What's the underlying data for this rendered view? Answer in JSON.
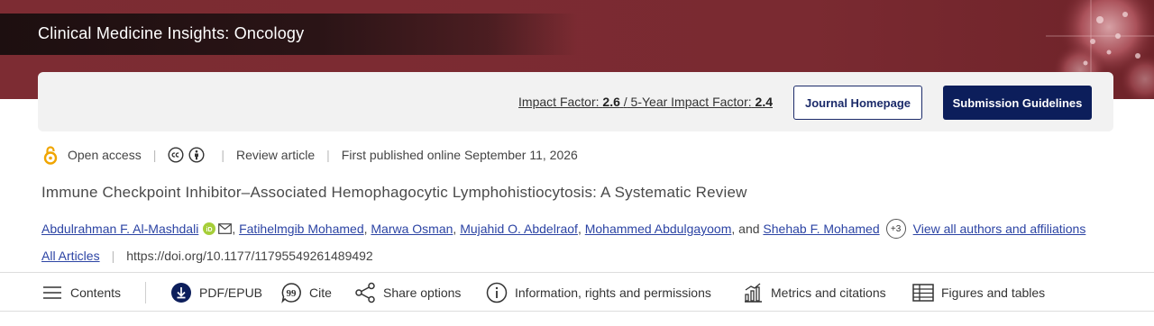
{
  "journal": {
    "title": "Clinical Medicine Insights: Oncology"
  },
  "info_bar": {
    "impact_label": "Impact Factor:",
    "impact_value": "2.6",
    "slash": "/",
    "five_year_label": "5-Year Impact Factor:",
    "five_year_value": "2.4",
    "homepage_button": "Journal Homepage",
    "guidelines_button": "Submission Guidelines"
  },
  "meta": {
    "access": "Open access",
    "article_type": "Review article",
    "published": "First published online September 11, 2026",
    "separator": "|"
  },
  "article": {
    "title": "Immune Checkpoint Inhibitor–Associated Hemophagocytic Lymphohistiocytosis: A Systematic Review",
    "authors": [
      "Abdulrahman F. Al-Mashdali",
      "Fatihelmgib Mohamed",
      "Marwa Osman",
      "Mujahid O. Abdelraof",
      "Mohammed Abdulgayoom",
      "Shehab F. Mohamed"
    ],
    "comma": ",",
    "and_text": ", and",
    "more_authors": "+3",
    "view_all": "View all authors and affiliations",
    "all_articles": "All Articles",
    "doi": "https://doi.org/10.1177/11795549261489492"
  },
  "toolbar": {
    "contents": "Contents",
    "pdf": "PDF/EPUB",
    "cite": "Cite",
    "share": "Share options",
    "info": "Information, rights and permissions",
    "metrics": "Metrics and citations",
    "figures": "Figures and tables"
  },
  "colors": {
    "banner": "#7d2c33",
    "primary_button": "#0c1e5b",
    "link": "#2c44a4",
    "open_access_icon": "#f0a500",
    "orcid": "#a6ce39"
  }
}
